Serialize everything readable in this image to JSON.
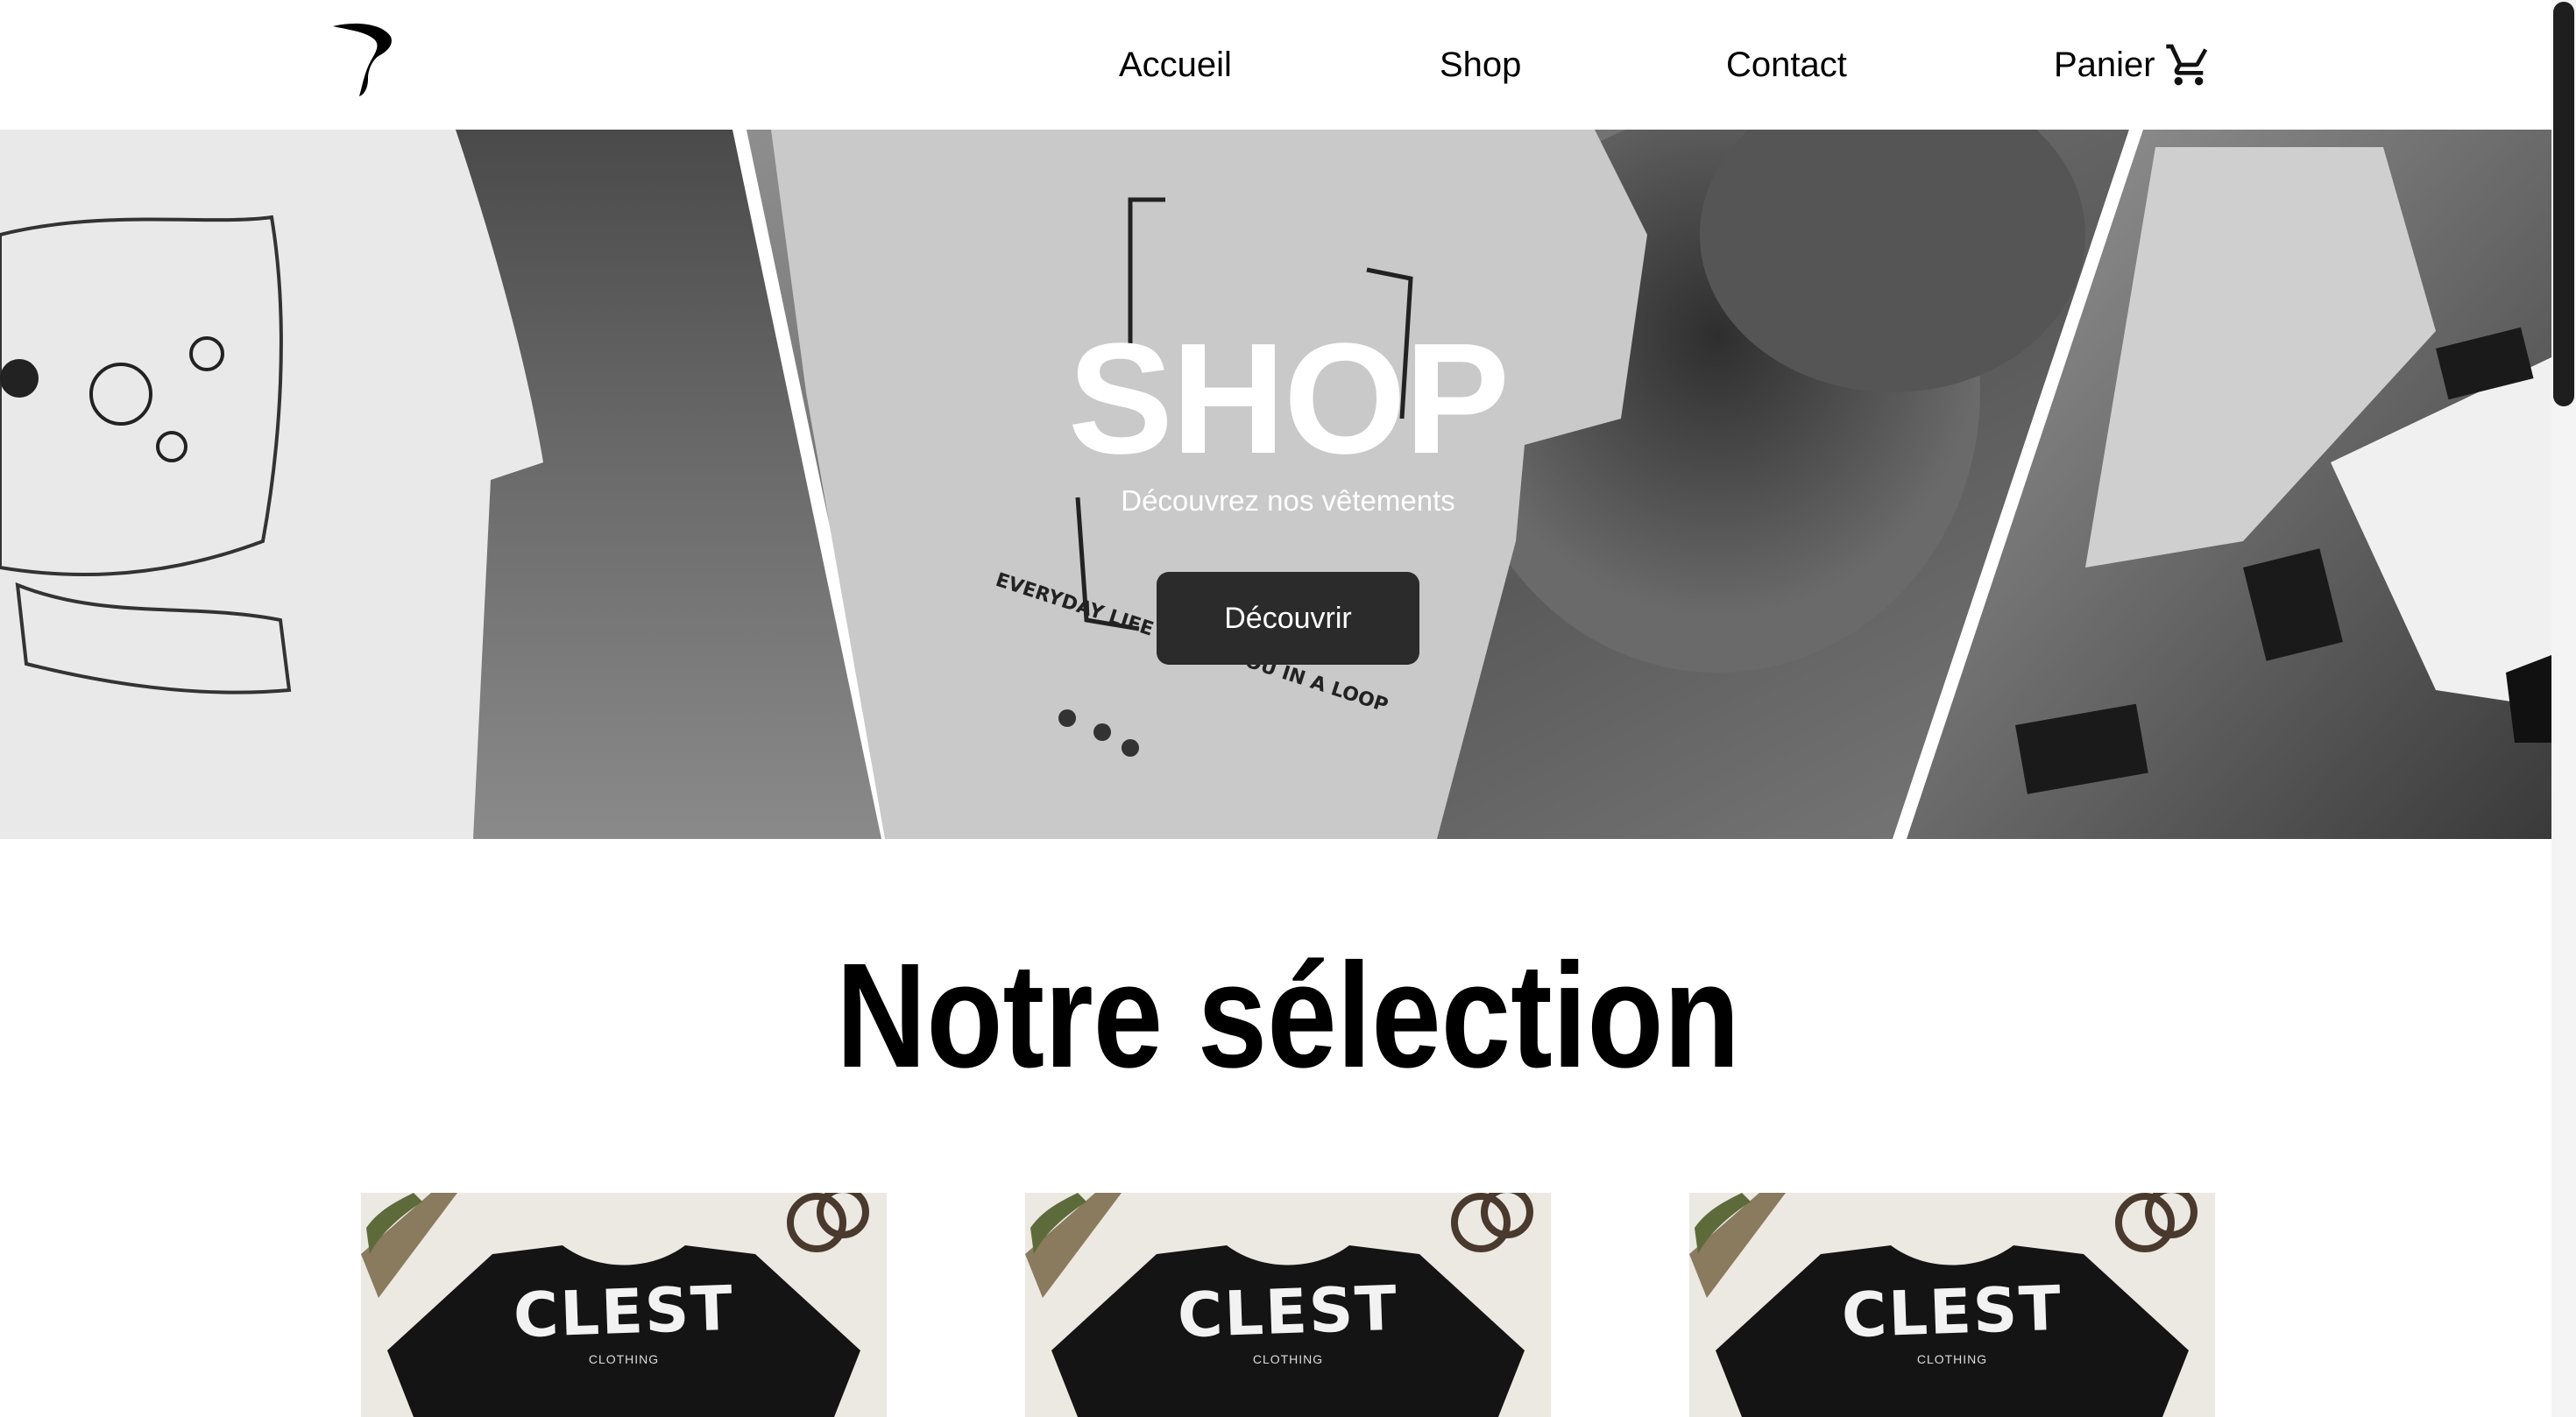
{
  "nav": {
    "logo_icon": "brand-logo-icon",
    "links": {
      "home": "Accueil",
      "shop": "Shop",
      "contact": "Contact",
      "cart": "Panier"
    },
    "cart_icon": "cart-icon"
  },
  "hero": {
    "title": "SHOP",
    "subtitle": "Découvrez nos vêtements",
    "cta_label": "Découvrir"
  },
  "selection": {
    "title": "Notre sélection",
    "products": [
      {
        "brand": "CLEST",
        "sub": "CLOTHING"
      },
      {
        "brand": "CLEST",
        "sub": "CLOTHING"
      },
      {
        "brand": "CLEST",
        "sub": "CLOTHING"
      }
    ]
  },
  "colors": {
    "cta_background": "#2b2b2b",
    "text": "#000000",
    "background": "#ffffff",
    "scrollbar_thumb": "#1e1e1e"
  }
}
